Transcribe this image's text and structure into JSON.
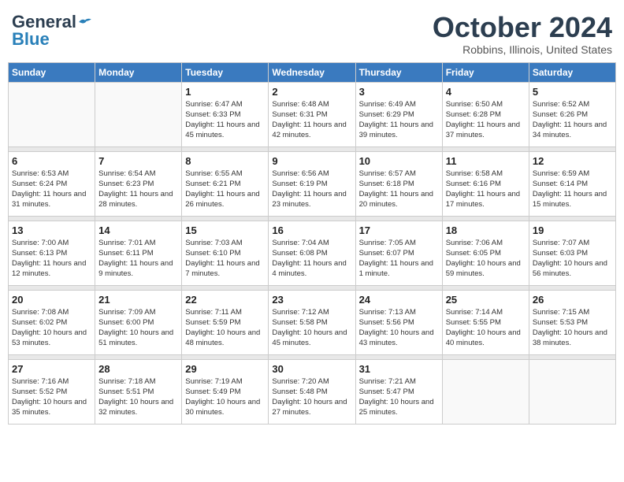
{
  "header": {
    "logo_general": "General",
    "logo_blue": "Blue",
    "month": "October 2024",
    "location": "Robbins, Illinois, United States"
  },
  "days_of_week": [
    "Sunday",
    "Monday",
    "Tuesday",
    "Wednesday",
    "Thursday",
    "Friday",
    "Saturday"
  ],
  "weeks": [
    [
      {
        "day": "",
        "info": ""
      },
      {
        "day": "",
        "info": ""
      },
      {
        "day": "1",
        "info": "Sunrise: 6:47 AM\nSunset: 6:33 PM\nDaylight: 11 hours and 45 minutes."
      },
      {
        "day": "2",
        "info": "Sunrise: 6:48 AM\nSunset: 6:31 PM\nDaylight: 11 hours and 42 minutes."
      },
      {
        "day": "3",
        "info": "Sunrise: 6:49 AM\nSunset: 6:29 PM\nDaylight: 11 hours and 39 minutes."
      },
      {
        "day": "4",
        "info": "Sunrise: 6:50 AM\nSunset: 6:28 PM\nDaylight: 11 hours and 37 minutes."
      },
      {
        "day": "5",
        "info": "Sunrise: 6:52 AM\nSunset: 6:26 PM\nDaylight: 11 hours and 34 minutes."
      }
    ],
    [
      {
        "day": "6",
        "info": "Sunrise: 6:53 AM\nSunset: 6:24 PM\nDaylight: 11 hours and 31 minutes."
      },
      {
        "day": "7",
        "info": "Sunrise: 6:54 AM\nSunset: 6:23 PM\nDaylight: 11 hours and 28 minutes."
      },
      {
        "day": "8",
        "info": "Sunrise: 6:55 AM\nSunset: 6:21 PM\nDaylight: 11 hours and 26 minutes."
      },
      {
        "day": "9",
        "info": "Sunrise: 6:56 AM\nSunset: 6:19 PM\nDaylight: 11 hours and 23 minutes."
      },
      {
        "day": "10",
        "info": "Sunrise: 6:57 AM\nSunset: 6:18 PM\nDaylight: 11 hours and 20 minutes."
      },
      {
        "day": "11",
        "info": "Sunrise: 6:58 AM\nSunset: 6:16 PM\nDaylight: 11 hours and 17 minutes."
      },
      {
        "day": "12",
        "info": "Sunrise: 6:59 AM\nSunset: 6:14 PM\nDaylight: 11 hours and 15 minutes."
      }
    ],
    [
      {
        "day": "13",
        "info": "Sunrise: 7:00 AM\nSunset: 6:13 PM\nDaylight: 11 hours and 12 minutes."
      },
      {
        "day": "14",
        "info": "Sunrise: 7:01 AM\nSunset: 6:11 PM\nDaylight: 11 hours and 9 minutes."
      },
      {
        "day": "15",
        "info": "Sunrise: 7:03 AM\nSunset: 6:10 PM\nDaylight: 11 hours and 7 minutes."
      },
      {
        "day": "16",
        "info": "Sunrise: 7:04 AM\nSunset: 6:08 PM\nDaylight: 11 hours and 4 minutes."
      },
      {
        "day": "17",
        "info": "Sunrise: 7:05 AM\nSunset: 6:07 PM\nDaylight: 11 hours and 1 minute."
      },
      {
        "day": "18",
        "info": "Sunrise: 7:06 AM\nSunset: 6:05 PM\nDaylight: 10 hours and 59 minutes."
      },
      {
        "day": "19",
        "info": "Sunrise: 7:07 AM\nSunset: 6:03 PM\nDaylight: 10 hours and 56 minutes."
      }
    ],
    [
      {
        "day": "20",
        "info": "Sunrise: 7:08 AM\nSunset: 6:02 PM\nDaylight: 10 hours and 53 minutes."
      },
      {
        "day": "21",
        "info": "Sunrise: 7:09 AM\nSunset: 6:00 PM\nDaylight: 10 hours and 51 minutes."
      },
      {
        "day": "22",
        "info": "Sunrise: 7:11 AM\nSunset: 5:59 PM\nDaylight: 10 hours and 48 minutes."
      },
      {
        "day": "23",
        "info": "Sunrise: 7:12 AM\nSunset: 5:58 PM\nDaylight: 10 hours and 45 minutes."
      },
      {
        "day": "24",
        "info": "Sunrise: 7:13 AM\nSunset: 5:56 PM\nDaylight: 10 hours and 43 minutes."
      },
      {
        "day": "25",
        "info": "Sunrise: 7:14 AM\nSunset: 5:55 PM\nDaylight: 10 hours and 40 minutes."
      },
      {
        "day": "26",
        "info": "Sunrise: 7:15 AM\nSunset: 5:53 PM\nDaylight: 10 hours and 38 minutes."
      }
    ],
    [
      {
        "day": "27",
        "info": "Sunrise: 7:16 AM\nSunset: 5:52 PM\nDaylight: 10 hours and 35 minutes."
      },
      {
        "day": "28",
        "info": "Sunrise: 7:18 AM\nSunset: 5:51 PM\nDaylight: 10 hours and 32 minutes."
      },
      {
        "day": "29",
        "info": "Sunrise: 7:19 AM\nSunset: 5:49 PM\nDaylight: 10 hours and 30 minutes."
      },
      {
        "day": "30",
        "info": "Sunrise: 7:20 AM\nSunset: 5:48 PM\nDaylight: 10 hours and 27 minutes."
      },
      {
        "day": "31",
        "info": "Sunrise: 7:21 AM\nSunset: 5:47 PM\nDaylight: 10 hours and 25 minutes."
      },
      {
        "day": "",
        "info": ""
      },
      {
        "day": "",
        "info": ""
      }
    ]
  ]
}
